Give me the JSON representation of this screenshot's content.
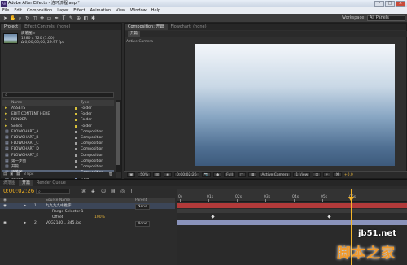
{
  "window": {
    "title": "Adobe After Effects - 连环流程.aep *",
    "min": "–",
    "max": "□",
    "close": "×",
    "app_icon": "Ae"
  },
  "menu": [
    "File",
    "Edit",
    "Composition",
    "Layer",
    "Effect",
    "Animation",
    "View",
    "Window",
    "Help"
  ],
  "toolbar": {
    "workspace_label": "Workspace:",
    "workspace_value": "All Panels"
  },
  "project": {
    "tabs": [
      "Project",
      "Effect Controls: (none)"
    ],
    "selected_name": "滴落图 ▾",
    "info_lines": [
      "1280 x 720 (1.00)",
      "Δ 0;00;06;00, 29.97 fps"
    ],
    "search_placeholder": "",
    "columns": {
      "name": "Name",
      "type": "Type"
    },
    "items": [
      {
        "name": "ASSETS",
        "type": "Folder",
        "icon": "folder",
        "swatch": "#d6c03b"
      },
      {
        "name": "EDIT CONTENT HERE",
        "type": "Folder",
        "icon": "folder",
        "swatch": "#d6c03b"
      },
      {
        "name": "RENDER",
        "type": "Folder",
        "icon": "folder",
        "swatch": "#d6c03b"
      },
      {
        "name": "Solids",
        "type": "Folder",
        "icon": "folder",
        "swatch": "#d6c03b"
      },
      {
        "name": "FLOWCHART_A",
        "type": "Composition",
        "icon": "comp",
        "swatch": "#a0a0a0"
      },
      {
        "name": "FLOWCHART_B",
        "type": "Composition",
        "icon": "comp",
        "swatch": "#a0a0a0"
      },
      {
        "name": "FLOWCHART_C",
        "type": "Composition",
        "icon": "comp",
        "swatch": "#a0a0a0"
      },
      {
        "name": "FLOWCHART_D",
        "type": "Composition",
        "icon": "comp",
        "swatch": "#a0a0a0"
      },
      {
        "name": "FLOWCHART_E",
        "type": "Composition",
        "icon": "comp",
        "swatch": "#a0a0a0"
      },
      {
        "name": "第一步图",
        "type": "Composition",
        "icon": "comp",
        "swatch": "#a0a0a0"
      },
      {
        "name": "开篇",
        "type": "Composition",
        "icon": "comp",
        "swatch": "#a0a0a0"
      },
      {
        "name": "滴落图",
        "type": "Composition",
        "icon": "comp",
        "swatch": "#a0a0a0",
        "selected": true
      },
      {
        "name": "48.jpg",
        "type": "JPEG",
        "icon": "image",
        "swatch": "#7f8fb0"
      },
      {
        "name": "VCG21400085945.jpg",
        "type": "JPEG",
        "icon": "image",
        "swatch": "#7f8fb0"
      }
    ],
    "footer": {
      "bpc": "8 bpc"
    }
  },
  "composition": {
    "tabs": [
      "Composition: 开篇",
      "Flowchart: (none)"
    ],
    "subtab": "开篇",
    "camera_label": "Active Camera",
    "bottom": {
      "zoom": "50%",
      "time": "0;00;02;26",
      "resolution": "Full",
      "camera": "Active Camera",
      "views": "1 View",
      "offset": "+0.0"
    }
  },
  "timeline": {
    "tabs": [
      "滴落图",
      "开篇",
      "Render Queue"
    ],
    "timecode": "0;00;02;26",
    "columns": {
      "source": "Source Name",
      "parent": "Parent"
    },
    "layers": [
      {
        "num": "1",
        "name": "九九九九中推字...",
        "parent": "None",
        "selected": true
      },
      {
        "num": "",
        "name": "Range Selector 1",
        "parent": ""
      },
      {
        "num": "",
        "name": "Offset",
        "parent": "",
        "value": "100%"
      },
      {
        "num": "2",
        "name": "VCG2140....845.jpg",
        "parent": "None"
      }
    ],
    "ruler_ticks": [
      "0s",
      "01s",
      "02s",
      "03s",
      "04s",
      "05s",
      "06s"
    ],
    "layer_colors": {
      "layer1": "#b23a3a",
      "layer2": "#8a93bb"
    }
  },
  "watermark": {
    "line1": "jb51.net",
    "line2": "脚本之家"
  }
}
